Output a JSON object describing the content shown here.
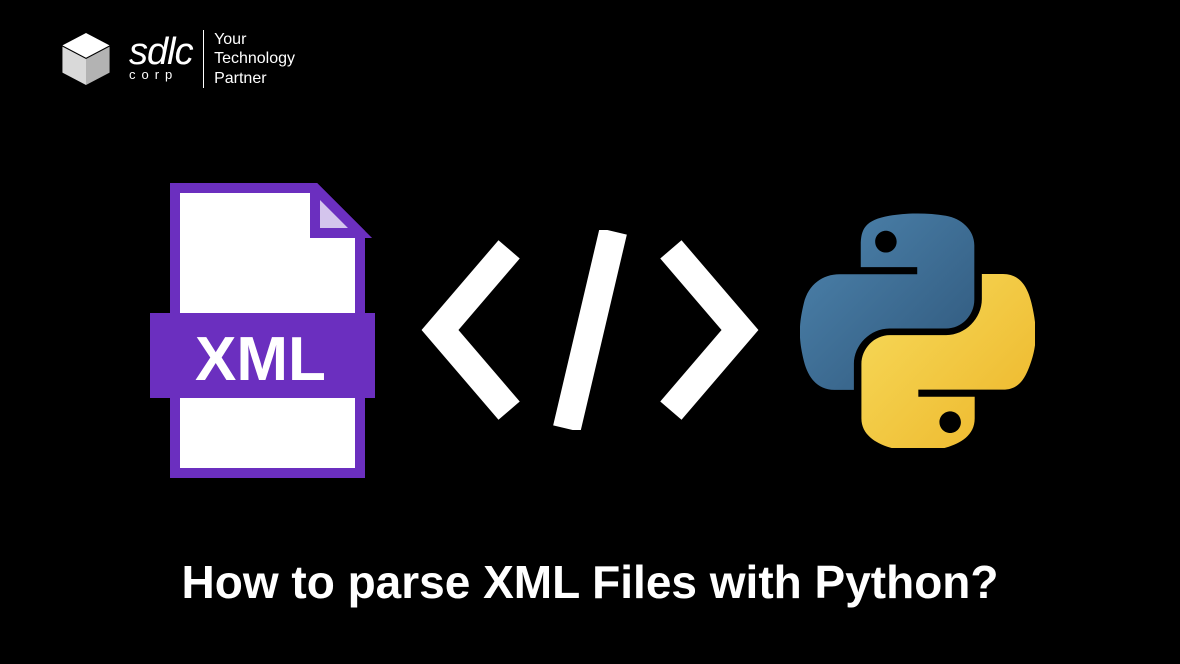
{
  "logo": {
    "brand_main": "sdlc",
    "brand_sub": "corp",
    "tagline_line1": "Your",
    "tagline_line2": "Technology",
    "tagline_line3": "Partner"
  },
  "xml_badge": "XML",
  "title": "How to parse XML Files with Python?",
  "colors": {
    "purple": "#6B2FBF",
    "purple_dark": "#5A1FA8",
    "python_blue": "#3E6F96",
    "python_yellow": "#F2C43C",
    "white": "#FFFFFF",
    "black": "#000000"
  }
}
